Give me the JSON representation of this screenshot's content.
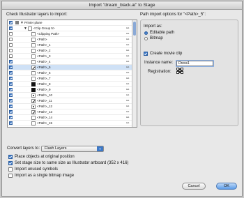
{
  "window": {
    "title": "Import \"dream_black.ai\" to Stage"
  },
  "layers": {
    "heading": "Check Illustrator layers to import:",
    "rows": [
      {
        "name": "Printer plane",
        "checked": true,
        "visible": true,
        "selected": false,
        "indent": 0,
        "expanded": true,
        "thumb": "none",
        "link": false
      },
      {
        "name": "<Clip Group 5>",
        "checked": true,
        "visible": false,
        "selected": false,
        "indent": 1,
        "expanded": true,
        "thumb": "plain",
        "link": true
      },
      {
        "name": "<Clipping Path>",
        "checked": false,
        "visible": false,
        "selected": false,
        "indent": 2,
        "expanded": false,
        "thumb": "plain",
        "link": true
      },
      {
        "name": "<Path>",
        "checked": false,
        "visible": false,
        "selected": false,
        "indent": 2,
        "expanded": false,
        "thumb": "plain",
        "link": true
      },
      {
        "name": "<Path>_1",
        "checked": false,
        "visible": false,
        "selected": false,
        "indent": 2,
        "expanded": false,
        "thumb": "plain",
        "link": true
      },
      {
        "name": "<Path>_2",
        "checked": false,
        "visible": false,
        "selected": false,
        "indent": 2,
        "expanded": false,
        "thumb": "plain",
        "link": true
      },
      {
        "name": "<Path>_3",
        "checked": false,
        "visible": false,
        "selected": false,
        "indent": 2,
        "expanded": false,
        "thumb": "plain",
        "link": true
      },
      {
        "name": "<Path>_4",
        "checked": true,
        "visible": false,
        "selected": false,
        "indent": 2,
        "expanded": false,
        "thumb": "plain",
        "link": true
      },
      {
        "name": "<Path>_5",
        "checked": true,
        "visible": false,
        "selected": true,
        "indent": 2,
        "expanded": false,
        "thumb": "slash",
        "link": true
      },
      {
        "name": "<Path>_6",
        "checked": true,
        "visible": false,
        "selected": false,
        "indent": 2,
        "expanded": false,
        "thumb": "plain",
        "link": true
      },
      {
        "name": "<Path>_7",
        "checked": true,
        "visible": false,
        "selected": false,
        "indent": 2,
        "expanded": false,
        "thumb": "plain",
        "link": true
      },
      {
        "name": "<Path>_8",
        "checked": true,
        "visible": false,
        "selected": false,
        "indent": 2,
        "expanded": false,
        "thumb": "dark",
        "link": true
      },
      {
        "name": "<Path>_9",
        "checked": true,
        "visible": false,
        "selected": false,
        "indent": 2,
        "expanded": false,
        "thumb": "dark",
        "link": true
      },
      {
        "name": "<Path>_10",
        "checked": true,
        "visible": false,
        "selected": false,
        "indent": 2,
        "expanded": false,
        "thumb": "dot",
        "link": true
      },
      {
        "name": "<Path>_11",
        "checked": true,
        "visible": false,
        "selected": false,
        "indent": 2,
        "expanded": false,
        "thumb": "slash",
        "link": true
      },
      {
        "name": "<Path>_12",
        "checked": true,
        "visible": false,
        "selected": false,
        "indent": 2,
        "expanded": false,
        "thumb": "dot",
        "link": true
      },
      {
        "name": "<Path>_13",
        "checked": true,
        "visible": false,
        "selected": false,
        "indent": 2,
        "expanded": false,
        "thumb": "slash",
        "link": true
      },
      {
        "name": "<Path>_14",
        "checked": true,
        "visible": false,
        "selected": false,
        "indent": 2,
        "expanded": false,
        "thumb": "plain",
        "link": true
      },
      {
        "name": "<Path>_15",
        "checked": true,
        "visible": false,
        "selected": false,
        "indent": 2,
        "expanded": false,
        "thumb": "plain",
        "link": true
      }
    ]
  },
  "options": {
    "heading": "Path import options for \"<Path>_5\":",
    "import_as_label": "Import as:",
    "editable_path_label": "Editable path",
    "bitmap_label": "Bitmap",
    "import_as_selected": "Editable path",
    "create_movie_clip_label": "Create movie clip",
    "create_movie_clip_checked": true,
    "instance_name_label": "Instance name:",
    "instance_name_value": "Dress1",
    "registration_label": "Registration:"
  },
  "bottom": {
    "convert_label": "Convert layers to:",
    "convert_value": "Flash Layers",
    "place_objects_label": "Place objects at original position",
    "place_objects_checked": true,
    "set_stage_label": "Set stage size to same size as Illustrator artboard (352 x 416)",
    "set_stage_checked": true,
    "import_unused_label": "Import unused symbols",
    "import_unused_checked": false,
    "single_bitmap_label": "Import as a single bitmap image",
    "single_bitmap_checked": false
  },
  "buttons": {
    "cancel": "Cancel",
    "ok": "OK"
  },
  "colors": {
    "accent": "#3d79c8",
    "selection": "#cfe1f6"
  }
}
